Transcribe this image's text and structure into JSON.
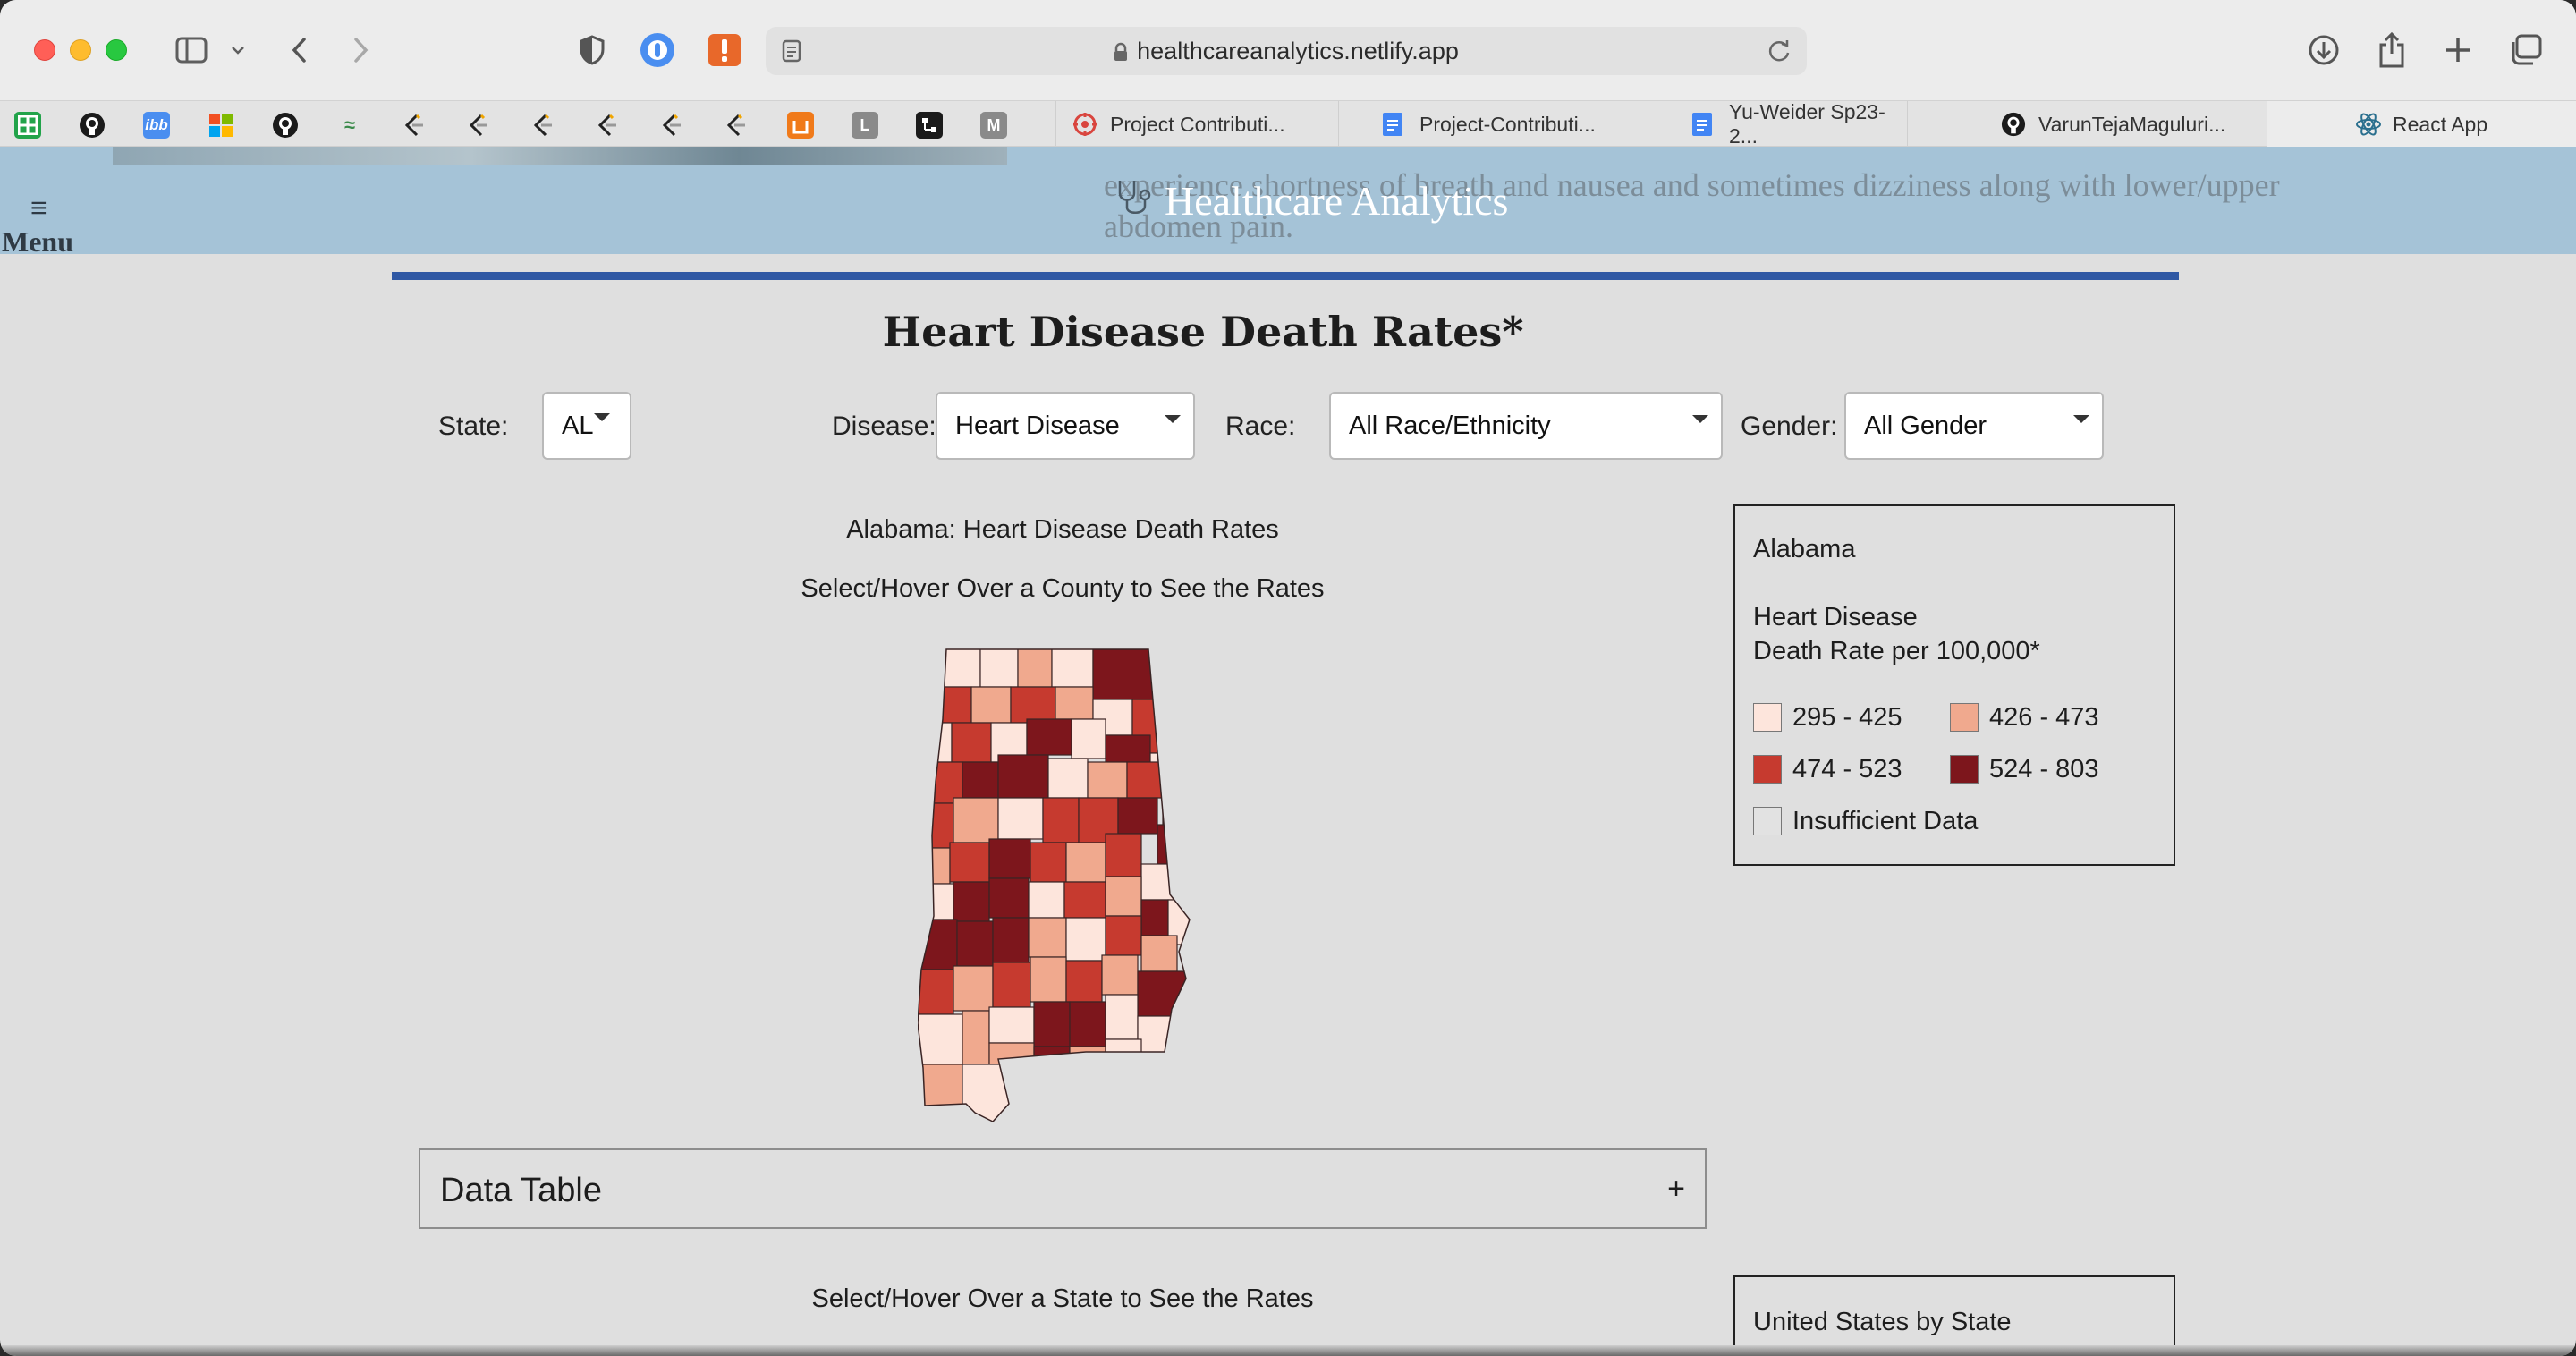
{
  "browser": {
    "url": "healthcareanalytics.netlify.app",
    "tabs": [
      {
        "label": "Project Contributi...",
        "icon": "scrum-icon"
      },
      {
        "label": "Project-Contributi...",
        "icon": "google-docs-icon"
      },
      {
        "label": "Yu-Weider Sp23-2...",
        "icon": "google-docs-icon"
      },
      {
        "label": "VarunTejaMaguluri...",
        "icon": "github-icon"
      },
      {
        "label": "React App",
        "icon": "react-icon"
      }
    ],
    "bookmarks": [
      "L",
      "M"
    ]
  },
  "header": {
    "menu_icon": "≡",
    "menu_label": "Menu",
    "brand_title": "Healthcare Analytics",
    "background_text_1": "experience shortness of breath and nausea and sometimes dizziness along with lower/upper",
    "background_text_2": "abdomen pain."
  },
  "page": {
    "title": "Heart Disease Death Rates*"
  },
  "filters": {
    "state_label": "State:",
    "state_value": "AL",
    "disease_label": "Disease:",
    "disease_value": "Heart Disease",
    "race_label": "Race:",
    "race_value": "All Race/Ethnicity",
    "gender_label": "Gender:",
    "gender_value": "All Gender"
  },
  "map": {
    "title": "Alabama: Heart Disease Death Rates",
    "subtitle": "Select/Hover Over a County to See the Rates"
  },
  "legend": {
    "state": "Alabama",
    "line1": "Heart Disease",
    "line2": "Death Rate per 100,000*",
    "items": [
      {
        "label": "295 - 425",
        "color": "#fde5dc"
      },
      {
        "label": "426 - 473",
        "color": "#f0a98e"
      },
      {
        "label": "474 - 523",
        "color": "#c63a2f"
      },
      {
        "label": "524 - 803",
        "color": "#7d161c"
      },
      {
        "label": "Insufficient Data",
        "color": "#e2e2e2"
      }
    ]
  },
  "data_table": {
    "title": "Data Table",
    "toggle": "+"
  },
  "us_section": {
    "subtitle": "Select/Hover Over a State to See the Rates",
    "box_title": "United States by State"
  }
}
